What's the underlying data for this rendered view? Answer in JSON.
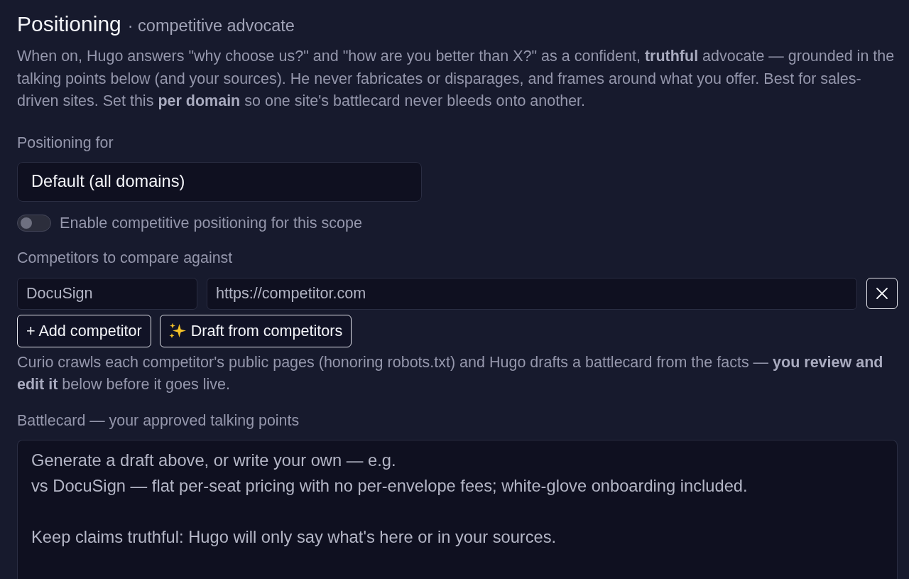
{
  "header": {
    "title": "Positioning",
    "subtitle": "· competitive advocate"
  },
  "description": "When on, Hugo answers \"why choose us?\" and \"how are you better than X?\" as a confident, **truthful** advocate — grounded in the talking points below (and your sources). He never fabricates or disparages, and frames around what you offer. Best for sales-driven sites. Set this **per domain** so one site's battlecard never bleeds onto another.",
  "scope": {
    "label": "Positioning for",
    "value": "Default (all domains)"
  },
  "enable": {
    "label": "Enable competitive positioning for this scope",
    "on": false
  },
  "competitors": {
    "label": "Competitors to compare against",
    "rows": [
      {
        "name_placeholder": "DocuSign",
        "url_placeholder": "https://competitor.com"
      }
    ]
  },
  "buttons": [
    {
      "kind": "add",
      "label": "+ Add competitor"
    },
    {
      "kind": "draft",
      "label": "Draft from competitors"
    }
  ],
  "help": "Curio crawls each competitor's public pages (honoring robots.txt) and Hugo drafts a battlecard from the facts — **you review and edit it** below before it goes live.",
  "battlecard": {
    "label": "Battlecard — your approved talking points",
    "placeholder": "Generate a draft above, or write your own — e.g.\nvs DocuSign — flat per-seat pricing with no per-envelope fees; white-glove onboarding included.\n\nKeep claims truthful: Hugo will only say what's here or in your sources."
  }
}
